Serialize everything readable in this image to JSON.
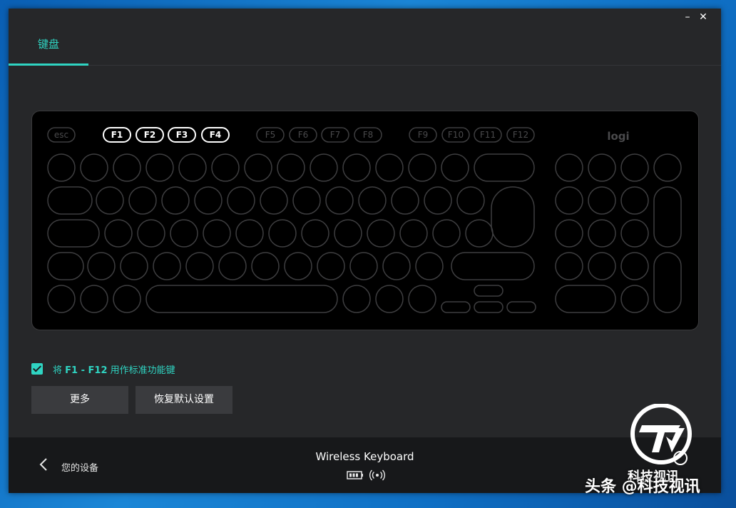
{
  "window": {
    "minimize_glyph": "–",
    "close_glyph": "✕"
  },
  "tabs": [
    {
      "label": "键盘",
      "active": true
    }
  ],
  "keyboard": {
    "esc_label": "esc",
    "fkeys": [
      {
        "label": "F1",
        "active": true
      },
      {
        "label": "F2",
        "active": true
      },
      {
        "label": "F3",
        "active": true
      },
      {
        "label": "F4",
        "active": true
      },
      {
        "label": "F5",
        "active": false
      },
      {
        "label": "F6",
        "active": false
      },
      {
        "label": "F7",
        "active": false
      },
      {
        "label": "F8",
        "active": false
      },
      {
        "label": "F9",
        "active": false
      },
      {
        "label": "F10",
        "active": false
      },
      {
        "label": "F11",
        "active": false
      },
      {
        "label": "F12",
        "active": false
      }
    ],
    "brand_logo": "logi"
  },
  "option": {
    "checked": true,
    "label_prefix": "将 ",
    "label_keys": "F1 - F12",
    "label_suffix": " 用作标准功能键"
  },
  "buttons": {
    "more": "更多",
    "reset": "恢复默认设置"
  },
  "footer": {
    "back_label": "您的设备",
    "device_name": "Wireless Keyboard",
    "battery_icon": "battery-icon",
    "connection_icon": "wireless-signal-icon"
  },
  "watermark": {
    "brand": "科技视讯",
    "source": "头条 @科技视讯"
  },
  "colors": {
    "accent": "#2fd4c2",
    "window_bg": "#262729",
    "footer_bg": "#17181a",
    "keyboard_bg": "#000000",
    "button_bg": "#3a3b3e"
  }
}
